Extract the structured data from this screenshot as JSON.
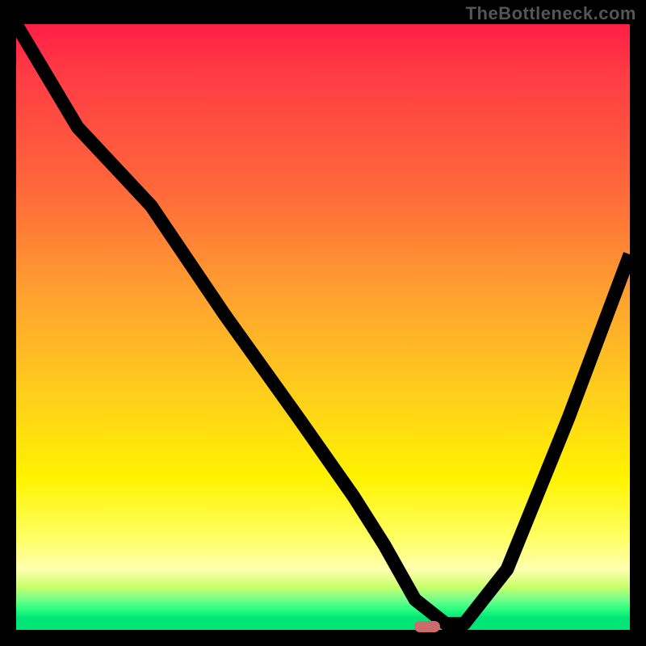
{
  "watermark": "TheBottleneck.com",
  "chart_data": {
    "type": "line",
    "title": "",
    "xlabel": "",
    "ylabel": "",
    "xlim": [
      0,
      100
    ],
    "ylim": [
      0,
      100
    ],
    "grid": false,
    "series": [
      {
        "name": "bottleneck-curve",
        "x": [
          0,
          10,
          22,
          34,
          46,
          55,
          60,
          65,
          70,
          73,
          80,
          90,
          100
        ],
        "y": [
          100,
          83,
          70,
          52,
          35,
          22,
          14,
          5,
          1,
          1,
          10,
          35,
          62
        ]
      }
    ],
    "marker": {
      "x": 67,
      "y": 0.5,
      "color": "#cc6b6b"
    },
    "gradient_colors": [
      "#ff1e46",
      "#ff6a3a",
      "#ffd11a",
      "#ffff66",
      "#00e676"
    ]
  }
}
